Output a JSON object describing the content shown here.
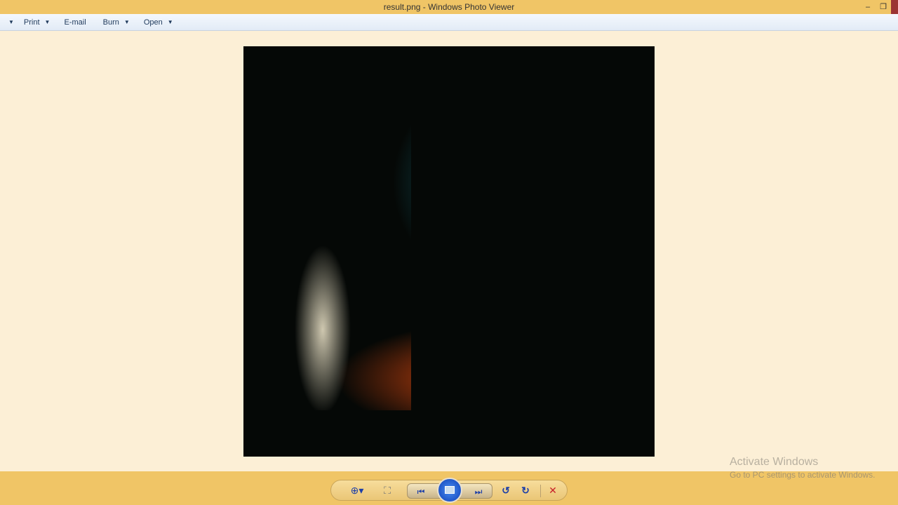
{
  "window": {
    "title": "result.png - Windows Photo Viewer",
    "minimize": "–",
    "restore": "❐"
  },
  "menu": {
    "items": [
      {
        "label": "Print",
        "dropdown": true
      },
      {
        "label": "E-mail",
        "dropdown": false
      },
      {
        "label": "Burn",
        "dropdown": true
      },
      {
        "label": "Open",
        "dropdown": true
      }
    ],
    "arrow": "▼"
  },
  "watermark": {
    "title": "Activate Windows",
    "subtitle": "Go to PC settings to activate Windows."
  },
  "toolbar": {
    "zoom": "⊕▾",
    "fit": "⛶",
    "previous": "⏮",
    "next": "⏭",
    "rotate_ccw": "↺",
    "rotate_cw": "↻",
    "delete": "✕"
  }
}
